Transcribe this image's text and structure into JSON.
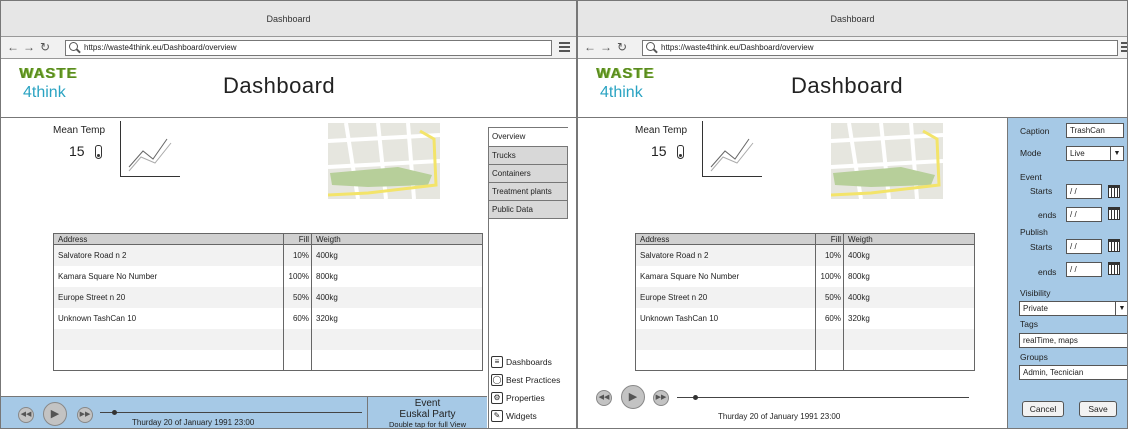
{
  "left": {
    "window_title": "Dashboard",
    "url": "https://waste4think.eu/Dashboard/overview",
    "logo": {
      "line1": "WASTE",
      "line2": "4think"
    },
    "page_title": "Dashboard",
    "mean_temp": {
      "label": "Mean Temp",
      "value": "15"
    },
    "table": {
      "headers": [
        "Address",
        "Fill",
        "Weigth"
      ],
      "rows": [
        [
          "Salvatore Road n 2",
          "10%",
          "400kg"
        ],
        [
          "Kamara Square  No Number",
          "100%",
          "800kg"
        ],
        [
          "Europe Street n 20",
          "50%",
          "400kg"
        ],
        [
          "Unknown TashCan 10",
          "60%",
          "320kg"
        ],
        [
          "",
          "",
          ""
        ],
        [
          "",
          "",
          ""
        ]
      ]
    },
    "tabs": [
      "Overview",
      "Trucks",
      "Containers",
      "Treatment plants",
      "Public Data"
    ],
    "side_links": [
      {
        "label": "Dashboards",
        "icon": "list-icon"
      },
      {
        "label": "Best Practices",
        "icon": "lightbulb-icon"
      },
      {
        "label": "Properties",
        "icon": "gear-icon"
      },
      {
        "label": "Widgets",
        "icon": "pencil-icon"
      }
    ],
    "player": {
      "time": "Thurday 20 of January 1991  23:00",
      "event_label": "Event",
      "event_name": "Euskal Party",
      "event_hint": "Double tap for full View"
    }
  },
  "right": {
    "window_title": "Dashboard",
    "url": "https://waste4think.eu/Dashboard/overview",
    "logo": {
      "line1": "WASTE",
      "line2": "4think"
    },
    "page_title": "Dashboard",
    "mean_temp": {
      "label": "Mean Temp",
      "value": "15"
    },
    "table": {
      "headers": [
        "Address",
        "Fill",
        "Weigth"
      ],
      "rows": [
        [
          "Salvatore Road n 2",
          "10%",
          "400kg"
        ],
        [
          "Kamara Square  No Number",
          "100%",
          "800kg"
        ],
        [
          "Europe Street n 20",
          "50%",
          "400kg"
        ],
        [
          "Unknown TashCan 10",
          "60%",
          "320kg"
        ],
        [
          "",
          "",
          ""
        ],
        [
          "",
          "",
          ""
        ]
      ]
    },
    "player": {
      "time": "Thurday 20 of January 1991  23:00"
    },
    "properties": {
      "caption_label": "Caption",
      "caption_value": "TrashCan",
      "mode_label": "Mode",
      "mode_value": "Live",
      "event_label": "Event",
      "starts_label": "Starts",
      "ends_label": "ends",
      "date_placeholder": "/ /",
      "publish_label": "Publish",
      "visibility_label": "Visibility",
      "visibility_value": "Private",
      "tags_label": "Tags",
      "tags_value": "realTime, maps",
      "groups_label": "Groups",
      "groups_value": "Admin, Tecnician",
      "cancel_label": "Cancel",
      "save_label": "Save"
    }
  },
  "colors": {
    "panel_blue": "#a6c9e6",
    "map_green": "#b7cf9a",
    "map_road_yellow": "#f3e46a"
  }
}
